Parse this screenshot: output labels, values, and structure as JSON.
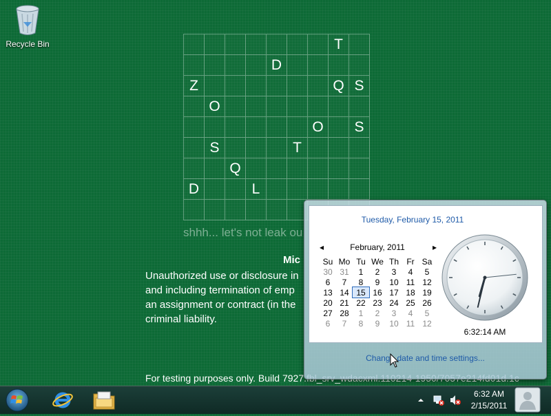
{
  "desktop": {
    "recycle_bin_label": "Recycle Bin",
    "grid_letters": [
      [
        "",
        "",
        "",
        "",
        "",
        "",
        "",
        "T",
        ""
      ],
      [
        "",
        "",
        "",
        "",
        "D",
        "",
        "",
        "",
        ""
      ],
      [
        "Z",
        "",
        "",
        "",
        "",
        "",
        "",
        "Q",
        "S"
      ],
      [
        "",
        "O",
        "",
        "",
        "",
        "",
        "",
        "",
        ""
      ],
      [
        "",
        "",
        "",
        "",
        "",
        "",
        "O",
        "",
        "S"
      ],
      [
        "",
        "S",
        "",
        "",
        "",
        "T",
        "",
        "",
        ""
      ],
      [
        "",
        "",
        "Q",
        "",
        "",
        "",
        "",
        "",
        ""
      ],
      [
        "D",
        "",
        "",
        "L",
        "",
        "",
        "",
        "",
        ""
      ],
      [
        "",
        "",
        "",
        "",
        "",
        "",
        "",
        "",
        ""
      ]
    ],
    "tagline": "shhh... let's not leak ou",
    "notice_title": "Mic",
    "notice_lines": [
      "Unauthorized use or disclosure in",
      "and including termination of emp",
      "an assignment or contract (in the",
      "criminal liability."
    ],
    "build_text": "For testing purposes only. Build 7927.fbl_srv_wdacxml.110214-1950/7057e214fd01d.1c"
  },
  "popup": {
    "full_date": "Tuesday, February 15, 2011",
    "month_label": "February, 2011",
    "prev_arrow": "◂",
    "next_arrow": "▸",
    "weekdays": [
      "Su",
      "Mo",
      "Tu",
      "We",
      "Th",
      "Fr",
      "Sa"
    ],
    "weeks": [
      [
        "30",
        "31",
        "1",
        "2",
        "3",
        "4",
        "5"
      ],
      [
        "6",
        "7",
        "8",
        "9",
        "10",
        "11",
        "12"
      ],
      [
        "13",
        "14",
        "15",
        "16",
        "17",
        "18",
        "19"
      ],
      [
        "20",
        "21",
        "22",
        "23",
        "24",
        "25",
        "26"
      ],
      [
        "27",
        "28",
        "1",
        "2",
        "3",
        "4",
        "5"
      ],
      [
        "6",
        "7",
        "8",
        "9",
        "10",
        "11",
        "12"
      ]
    ],
    "muted_cells": [
      [
        0,
        0
      ],
      [
        0,
        1
      ],
      [
        4,
        2
      ],
      [
        4,
        3
      ],
      [
        4,
        4
      ],
      [
        4,
        5
      ],
      [
        4,
        6
      ],
      [
        5,
        0
      ],
      [
        5,
        1
      ],
      [
        5,
        2
      ],
      [
        5,
        3
      ],
      [
        5,
        4
      ],
      [
        5,
        5
      ],
      [
        5,
        6
      ]
    ],
    "today_cell": [
      2,
      2
    ],
    "digital_time": "6:32:14 AM",
    "analog_time": {
      "hour": 6,
      "minute": 32,
      "second": 14
    },
    "change_link": "Change date and time settings..."
  },
  "taskbar": {
    "tray_time": "6:32 AM",
    "tray_date": "2/15/2011",
    "icons": [
      "windows-orb-icon",
      "internet-explorer-icon",
      "file-explorer-icon"
    ],
    "tray_icons": [
      "show-hidden-arrow-icon",
      "network-icon",
      "volume-muted-icon"
    ]
  },
  "colors": {
    "desktop_bg": "#0d6a36",
    "link_blue": "#1e5aa8"
  }
}
